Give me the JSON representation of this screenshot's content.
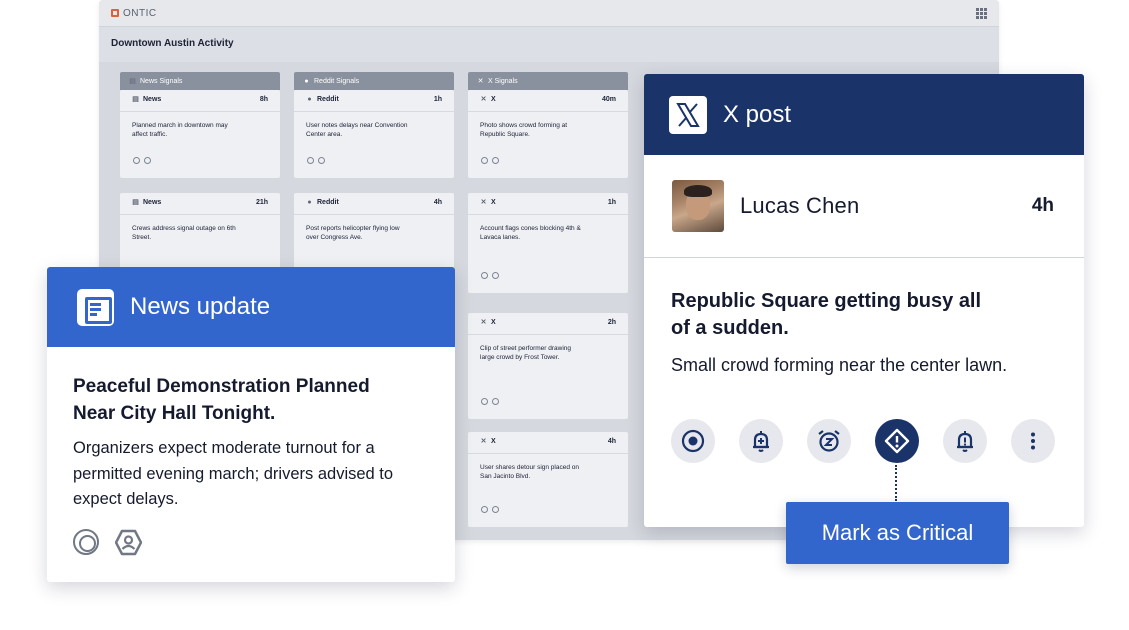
{
  "app": {
    "brand": "ONTIC",
    "page_title": "Downtown Austin Activity"
  },
  "columns": [
    {
      "label": "News Signals",
      "icon": "document-icon"
    },
    {
      "label": "Reddit Signals",
      "icon": "reddit-icon"
    },
    {
      "label": "X Signals",
      "icon": "x-icon"
    }
  ],
  "mini_cards": [
    {
      "source": "News",
      "time": "8h",
      "text": "Planned march in downtown may affect traffic."
    },
    {
      "source": "Reddit",
      "time": "1h",
      "text": "User notes delays near Convention Center area."
    },
    {
      "source": "X",
      "time": "40m",
      "text": "Photo shows crowd forming at Republic Square."
    },
    {
      "source": "News",
      "time": "21h",
      "text": "Crews address signal outage on 6th Street."
    },
    {
      "source": "Reddit",
      "time": "4h",
      "text": "Post reports helicopter flying low over Congress Ave."
    },
    {
      "source": "X",
      "time": "1h",
      "text": "Account flags cones blocking 4th & Lavaca lanes."
    },
    {
      "source": "X",
      "time": "2h",
      "text": "Clip of street performer drawing large crowd by Frost Tower."
    },
    {
      "source": "X",
      "time": "4h",
      "text": "User shares detour sign placed on San Jacinto Blvd."
    }
  ],
  "news_card": {
    "title": "News update",
    "headline": "Peaceful Demonstration Planned Near City Hall Tonight.",
    "description": "Organizers expect moderate turnout for a permitted evening march; drivers advised to expect delays.",
    "icons": [
      "target-icon",
      "profile-hex-icon"
    ]
  },
  "x_card": {
    "title": "X post",
    "author": "Lucas Chen",
    "time": "4h",
    "headline": "Republic Square getting busy all of a sudden.",
    "description": "Small crowd forming near the center lawn.",
    "actions": [
      "target-icon",
      "bell-add-icon",
      "snooze-alarm-icon",
      "critical-diamond-icon",
      "alert-bell-icon",
      "more-vertical-icon"
    ]
  },
  "tooltip": {
    "label": "Mark as Critical"
  },
  "colors": {
    "primary_blue": "#3366cc",
    "navy": "#1a3368",
    "brand_orange": "#e0603a"
  }
}
